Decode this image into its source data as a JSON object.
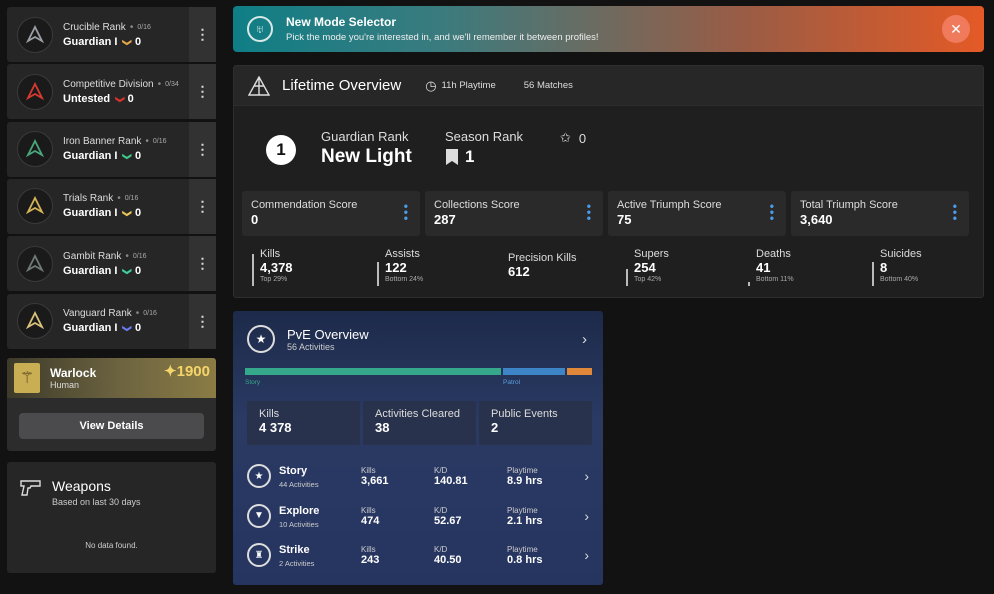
{
  "ranks": [
    {
      "title": "Crucible Rank",
      "count": "0/16",
      "sub": "Guardian I",
      "points": "0",
      "chev_color": "#e8a64a",
      "emblem_color": "#9aa0a6"
    },
    {
      "title": "Competitive Division",
      "count": "0/34",
      "sub": "Untested",
      "points": "0",
      "chev_color": "#e0332d",
      "emblem_color": "#d93a30"
    },
    {
      "title": "Iron Banner Rank",
      "count": "0/16",
      "sub": "Guardian I",
      "points": "0",
      "chev_color": "#3fc98a",
      "emblem_color": "#4aa77c"
    },
    {
      "title": "Trials Rank",
      "count": "0/16",
      "sub": "Guardian I",
      "points": "0",
      "chev_color": "#e8c65a",
      "emblem_color": "#d8b55a"
    },
    {
      "title": "Gambit Rank",
      "count": "0/16",
      "sub": "Guardian I",
      "points": "0",
      "chev_color": "#3fd0a0",
      "emblem_color": "#6f7b78"
    },
    {
      "title": "Vanguard Rank",
      "count": "0/16",
      "sub": "Guardian I",
      "points": "0",
      "chev_color": "#6a7cf0",
      "emblem_color": "#d9c27a"
    }
  ],
  "character": {
    "class": "Warlock",
    "race": "Human",
    "light": "1900",
    "button": "View Details"
  },
  "weapons": {
    "title": "Weapons",
    "subtitle": "Based on last 30 days",
    "empty": "No data found."
  },
  "banner": {
    "title": "New Mode Selector",
    "text": "Pick the mode you're interested in, and we'll remember it between profiles!"
  },
  "lifetime": {
    "title": "Lifetime Overview",
    "playtime": "11h Playtime",
    "matches": "56 Matches",
    "guardian_rank_num": "1",
    "guardian_rank_label": "Guardian Rank",
    "guardian_rank_name": "New Light",
    "season_rank_label": "Season Rank",
    "season_rank": "1",
    "star_value": "0",
    "scores": [
      {
        "label": "Commendation Score",
        "value": "0"
      },
      {
        "label": "Collections Score",
        "value": "287"
      },
      {
        "label": "Active Triumph Score",
        "value": "75"
      },
      {
        "label": "Total Triumph Score",
        "value": "3,640"
      }
    ],
    "stats": [
      {
        "label": "Kills",
        "value": "4,378",
        "note": "Top 29%",
        "bar": 0.95
      },
      {
        "label": "Assists",
        "value": "122",
        "note": "Bottom 24%",
        "bar": 0.7
      },
      {
        "label": "Precision Kills",
        "value": "612",
        "note": "",
        "bar": 0
      },
      {
        "label": "Supers",
        "value": "254",
        "note": "Top 42%",
        "bar": 0.5
      },
      {
        "label": "Deaths",
        "value": "41",
        "note": "Bottom 11%",
        "bar": 0.12
      },
      {
        "label": "Suicides",
        "value": "8",
        "note": "Bottom 40%",
        "bar": 0.7
      }
    ]
  },
  "pve": {
    "title": "PvE Overview",
    "subtitle": "56 Activities",
    "bar_story_label": "Story",
    "bar_patrol_label": "Patrol",
    "bar_story_fraction": 0.74,
    "bar_patrol_fraction": 0.18,
    "bar_other_fraction": 0.07,
    "boxes": [
      {
        "label": "Kills",
        "value": "4 378"
      },
      {
        "label": "Activities Cleared",
        "value": "38"
      },
      {
        "label": "Public Events",
        "value": "2"
      }
    ],
    "activities": [
      {
        "name": "Story",
        "count": "44 Activities",
        "kills": "3,661",
        "kd": "140.81",
        "playtime": "8.9 hrs",
        "icon": "★"
      },
      {
        "name": "Explore",
        "count": "10 Activities",
        "kills": "474",
        "kd": "52.67",
        "playtime": "2.1 hrs",
        "icon": "▼"
      },
      {
        "name": "Strike",
        "count": "2 Activities",
        "kills": "243",
        "kd": "40.50",
        "playtime": "0.8 hrs",
        "icon": "♜"
      }
    ],
    "col_kills": "Kills",
    "col_kd": "K/D",
    "col_playtime": "Playtime"
  }
}
